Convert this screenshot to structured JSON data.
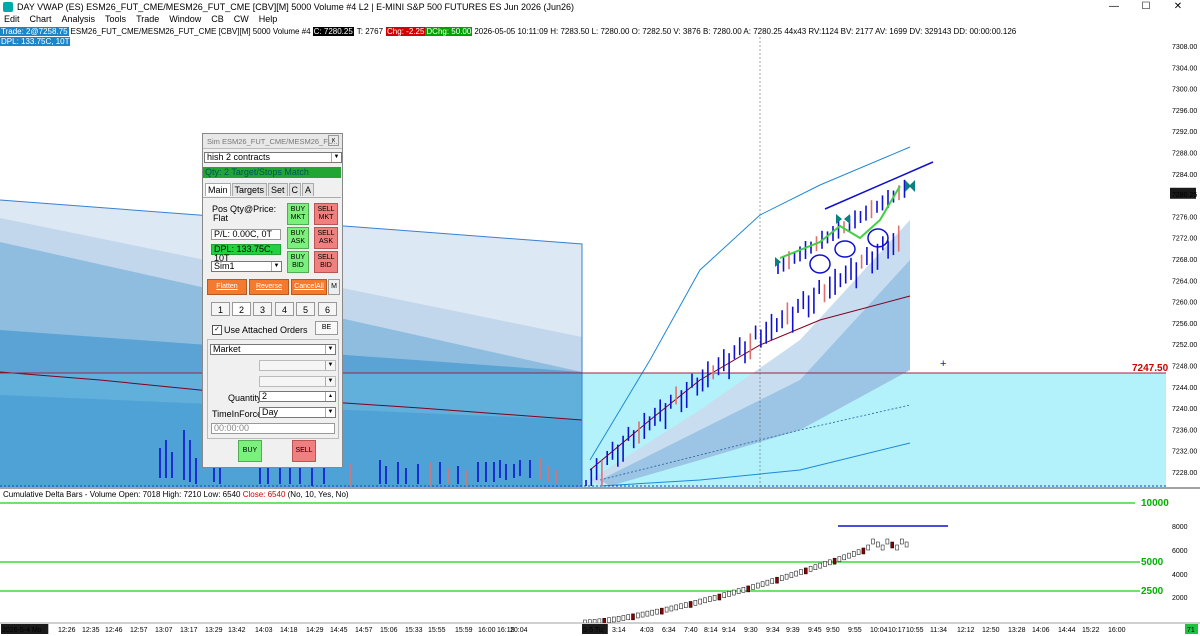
{
  "window": {
    "title": "DAY VWAP (ES) ESM26_FUT_CME/MESM26_FUT_CME [CBV][M]  5000 Volume #4 L2 | E-MINI S&P 500 FUTURES ES Jun 2026 (Jun26)",
    "min": "—",
    "max": "☐",
    "close": "✕"
  },
  "menu": [
    "Edit",
    "Chart",
    "Analysis",
    "Tools",
    "Trade",
    "Window",
    "CB",
    "CW",
    "Help"
  ],
  "info": {
    "trade": "Trade: 2@7258.75",
    "symbol": "ESM26_FUT_CME/MESM26_FUT_CME [CBV][M]  5000 Volume #4",
    "c": "C: 7280.25",
    "t": "T: 2767",
    "chg": "Chg: -2.25",
    "dchg": "DChg: 50.00",
    "rest": "2026-05-05 10:11:09 H: 7283.50 L: 7280.00 O: 7282.50 V: 3876 B: 7280.00 A: 7280.25 44x43 RV:1124 BV: 2177 AV: 1699 DV: 329143 DD: 00:00:00.126",
    "dpl": "DPL: 133.75C, 10T"
  },
  "price_axis": {
    "labels": [
      "7308.00",
      "7304.00",
      "7300.00",
      "7296.00",
      "7292.00",
      "7288.00",
      "7284.00",
      "7280.25",
      "7276.00",
      "7272.00",
      "7268.00",
      "7264.00",
      "7260.00",
      "7256.00",
      "7252.00",
      "7248.00",
      "7244.00",
      "7240.00",
      "7236.00",
      "7232.00",
      "7228.00"
    ],
    "current": "7280.25",
    "marker": "7247.50"
  },
  "indicator": {
    "title_prefix": "Cumulative Delta Bars - Volume  Open: 7018  High: 7210  Low: 6540  ",
    "close": "Close: 6540",
    "title_suffix": "  (No, 10, Yes, No)",
    "levels": [
      "10000",
      "8000",
      "6000",
      "5000",
      "4000",
      "2500",
      "2000"
    ]
  },
  "time_axis": {
    "labels": [
      "2026-5-4 Mo",
      "12:26",
      "12:35",
      "12:46",
      "12:57",
      "13:07",
      "13:17",
      "13:29",
      "13:42",
      "14:03",
      "14:18",
      "14:29",
      "14:45",
      "14:57",
      "15:06",
      "15:33",
      "15:55",
      "15:59",
      "16:00",
      "16:15",
      "20:04",
      "5-5 Tu",
      "3:14",
      "4:03",
      "6:34",
      "7:40",
      "8:14",
      "9:14",
      "9:30",
      "9:34",
      "9:39",
      "9:45",
      "9:50",
      "9:55",
      "10:04",
      "10:17",
      "10:55",
      "11:34",
      "12:12",
      "12:50",
      "13:28",
      "14:06",
      "14:44",
      "15:22",
      "16:00"
    ],
    "corner": "71"
  },
  "panel": {
    "header": "Sim ESM26_FUT_CME/MESM26_FU...",
    "close": "x",
    "strategy": "hish 2 contracts",
    "qty_line": "Qty: 2 Target/Stops Match",
    "tabs": [
      "Main",
      "Targets",
      "Set",
      "C",
      "A"
    ],
    "pos_label": "Pos Qty@Price:",
    "pos_value": "Flat",
    "pl": "P/L: 0.00C, 0T",
    "dpl": "DPL: 133.75C, 10T",
    "account": "Sim1",
    "buy_mkt": "BUY MKT",
    "sell_mkt": "SELL MKT",
    "buy_ask": "BUY ASK",
    "sell_ask": "SELL ASK",
    "buy_bid": "BUY BID",
    "sell_bid": "SELL BID",
    "flatten": "Flatten",
    "reverse": "Reverse",
    "cancel_all": "CancelAll",
    "m": "M",
    "nums": [
      "1",
      "2",
      "3",
      "4",
      "5",
      "6"
    ],
    "attached": "Use Attached Orders",
    "be": "BE",
    "order_type": "Market",
    "quantity_label": "Quantity:",
    "quantity": "2",
    "tif_label": "TimeInForce:",
    "tif": "Day",
    "time": "00:00:00",
    "buy": "BUY",
    "sell": "SELL"
  },
  "colors": {
    "up": "#1010d0",
    "down": "#e07070",
    "band_dark": "#5aa0d0",
    "band_mid": "#9cc4e4",
    "band_light": "#c8ddef",
    "cyan": "#b3f1fb"
  }
}
